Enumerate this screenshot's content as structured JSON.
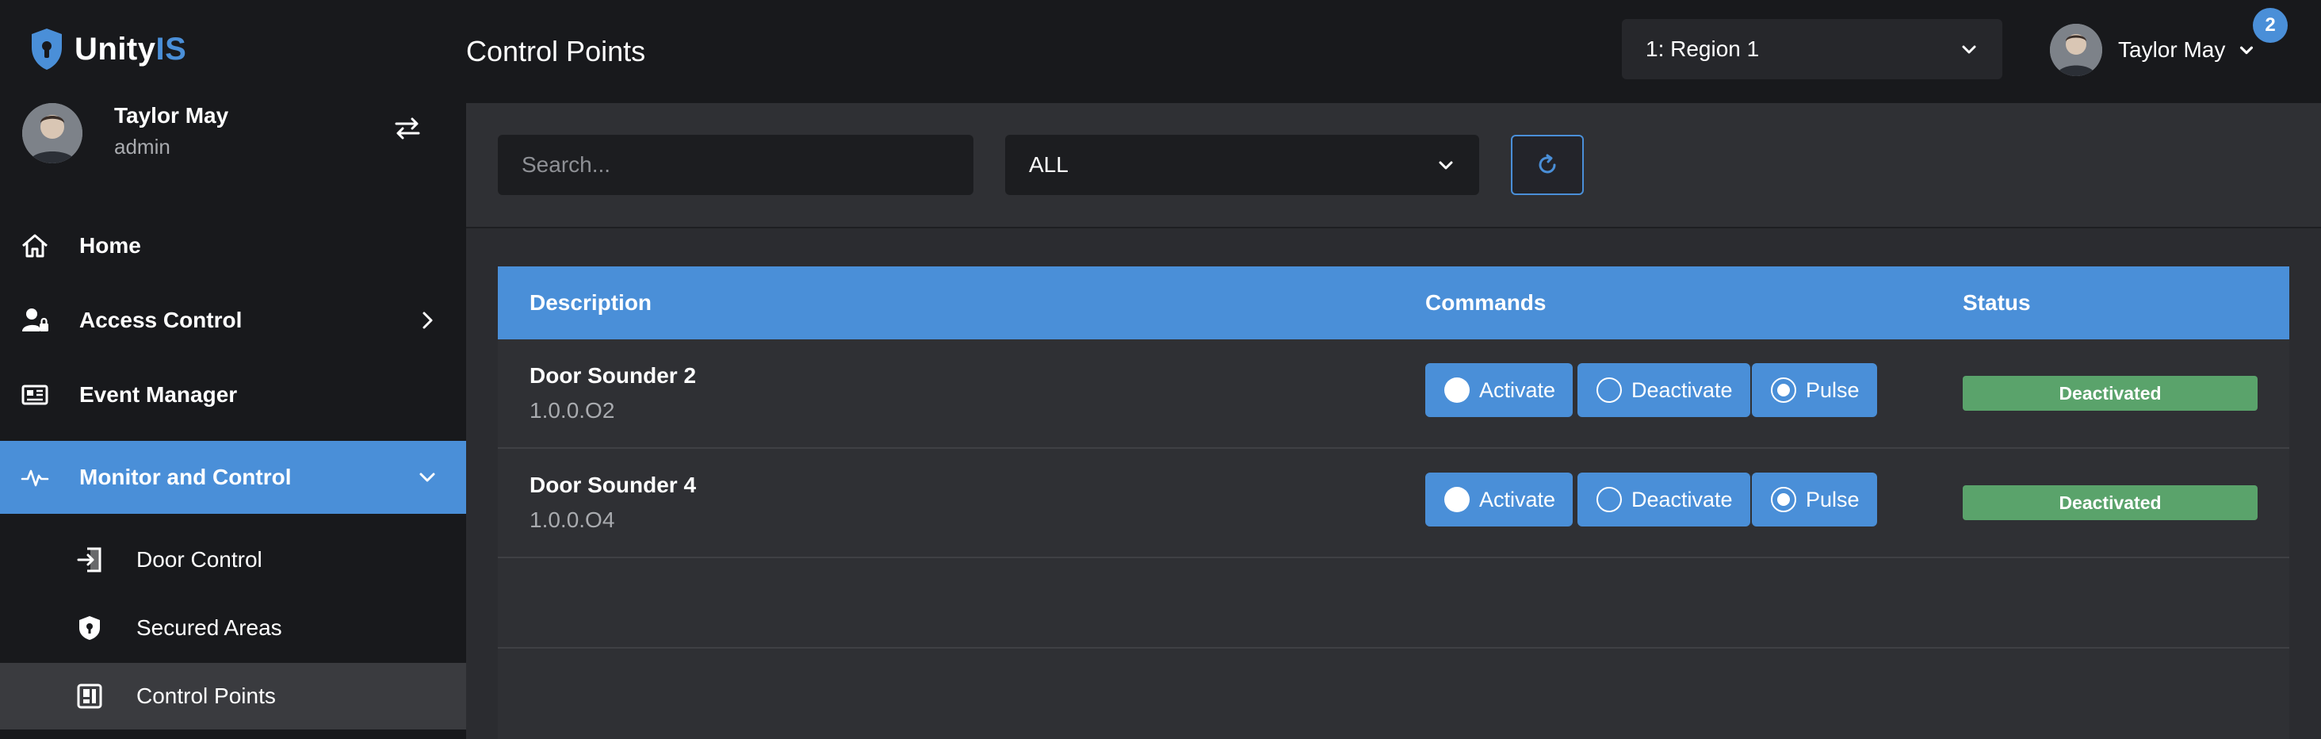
{
  "app": {
    "logo_prefix": "Unity",
    "logo_suffix": "IS",
    "page_title": "Control Points"
  },
  "header": {
    "region_value": "1: Region 1",
    "user_name": "Taylor May",
    "notification_count": "2"
  },
  "sidebar": {
    "profile": {
      "name": "Taylor May",
      "role": "admin"
    },
    "items": [
      {
        "label": "Home",
        "icon": "home-icon"
      },
      {
        "label": "Access Control",
        "icon": "user-lock-icon"
      },
      {
        "label": "Event Manager",
        "icon": "newspaper-icon"
      },
      {
        "label": "Monitor and Control",
        "icon": "pulse-icon"
      }
    ],
    "subitems": [
      {
        "label": "Door Control",
        "icon": "door-enter-icon"
      },
      {
        "label": "Secured Areas",
        "icon": "shield-icon"
      },
      {
        "label": "Control Points",
        "icon": "control-panel-icon"
      }
    ]
  },
  "filters": {
    "search_placeholder": "Search...",
    "type_value": "ALL"
  },
  "table": {
    "columns": [
      "Description",
      "Commands",
      "Status"
    ],
    "commands": {
      "activate": "Activate",
      "deactivate": "Deactivate",
      "pulse": "Pulse"
    },
    "rows": [
      {
        "description": "Door Sounder 2",
        "address": "1.0.0.O2",
        "status": "Deactivated"
      },
      {
        "description": "Door Sounder 4",
        "address": "1.0.0.O4",
        "status": "Deactivated"
      }
    ]
  },
  "colors": {
    "accent": "#4a8fd8",
    "status_deactivated": "#5aa36b",
    "sidebar_bg": "#18191c",
    "content_bg": "#2b2c30"
  }
}
